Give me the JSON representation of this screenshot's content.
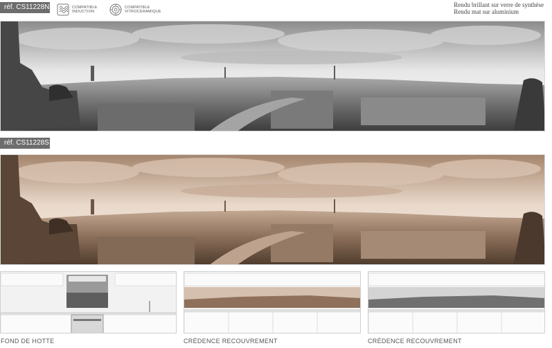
{
  "header": {
    "ref_top": "réf. CS11228N",
    "ref_bottom": "réf. CS11228S",
    "compat_induction": [
      "COMPATIBLE",
      "INDUCTION"
    ],
    "compat_vitro": [
      "COMPATIBLE",
      "VITROCÉRAMIQUE"
    ],
    "rendu_line1": "Rendu brillant sur verre de synthèse",
    "rendu_line2": "Rendu mat sur aluminium"
  },
  "icons": {
    "induction": "induction-coil-icon",
    "vitro": "vitroceramic-burner-icon"
  },
  "colors": {
    "tag_bg": "#6d6d6d",
    "sepia_sky": "#c9ae98",
    "sepia_dark": "#4d3a2c",
    "gray_sky": "#d9d9d9",
    "gray_dark": "#3b3b3b"
  },
  "previews": [
    {
      "label": "FOND DE HOTTE"
    },
    {
      "label": "CRÉDENCE RECOUVREMENT"
    },
    {
      "label": "CRÉDENCE RECOUVREMENT"
    }
  ]
}
